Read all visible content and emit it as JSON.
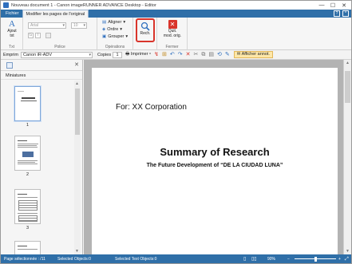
{
  "window": {
    "title": "Nouveau document 1 - Canon imageRUNNER ADVANCE Desktop - Editor",
    "controls": [
      "—",
      "☐",
      "✕"
    ]
  },
  "tabs": [
    {
      "label": "Fichier",
      "active": false
    },
    {
      "label": "Modifier les pages de l'original",
      "active": true
    }
  ],
  "ribbon": {
    "text_group": {
      "label": "Txt",
      "add_text": "Ajout\ntxt"
    },
    "font_group": {
      "label": "Police",
      "font_value": "Arial",
      "size_value": "10",
      "bold": "G",
      "italic": "I"
    },
    "ops_group": {
      "label": "Opérations",
      "align": "Aligner",
      "order": "Ordre",
      "group": "Grouper"
    },
    "search_btn": "Rech.",
    "close_group": {
      "label": "Fermer",
      "close_btn": "Quit.\nmod. orig."
    }
  },
  "toolbar": {
    "printer_label": "Emprim",
    "printer_value": "Canon iR-ADV",
    "copies_label": "Copies",
    "copies_value": "1",
    "print_btn": "Imprimer",
    "annot_btn": "Afficher annot."
  },
  "thumbnails": {
    "header": "Miniatures",
    "pages": [
      "1",
      "2",
      "3"
    ]
  },
  "document": {
    "for_line": "For: XX Corporation",
    "title": "Summary of Research",
    "subtitle": "The Future Development of “DE LA CIUDAD LUNA”"
  },
  "status": {
    "page_sel": "Page sélectionnée : /11",
    "selected_objects": "Selected Objects:0",
    "selected_text_objects": "Selected Text Objects:0",
    "zoom": "90%",
    "zoom_level": 0.5
  },
  "colors": {
    "accent": "#2f6fa8",
    "search_highlight": "#d9342b"
  }
}
